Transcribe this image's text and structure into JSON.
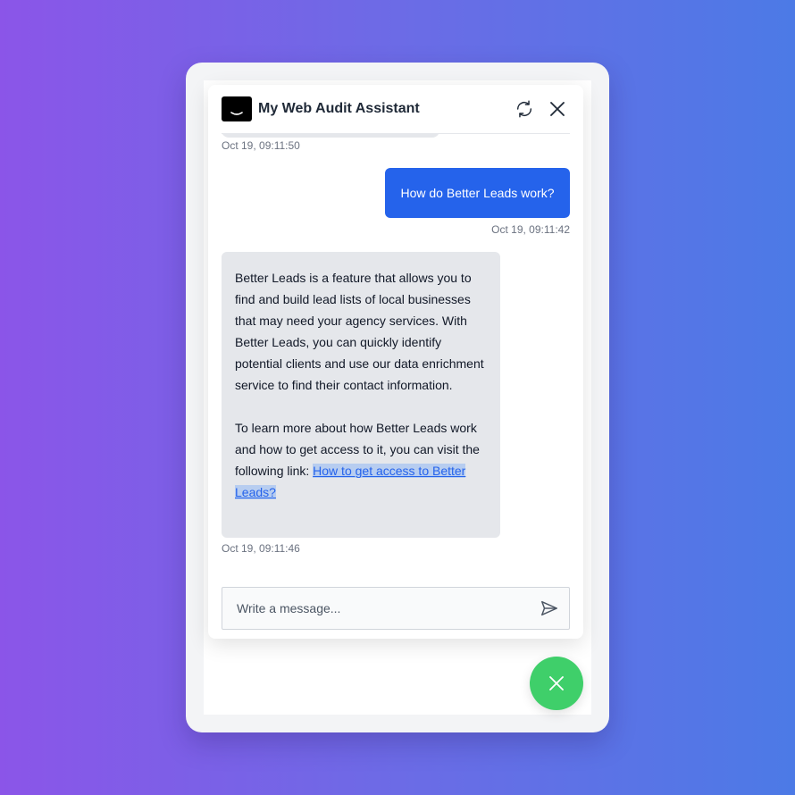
{
  "header": {
    "title": "My Web Audit Assistant",
    "logo_icon": "smile-logo-icon",
    "refresh_icon": "refresh-icon",
    "close_icon": "close-icon"
  },
  "messages": [
    {
      "role": "bot",
      "timestamp": "Oct 19, 09:11:50"
    },
    {
      "role": "user",
      "text": "How do Better Leads work?",
      "timestamp": "Oct 19, 09:11:42"
    },
    {
      "role": "bot",
      "paragraph_1": "Better Leads is a feature that allows you to find and build lead lists of local businesses that may need your agency services. With Better Leads, you can quickly identify potential clients and use our data enrichment service to find their contact information.",
      "paragraph_2_prefix": "To learn more about how Better Leads work and how to get access to it, you can visit the following link: ",
      "link_text": "How to get access to Better Leads?",
      "timestamp": "Oct 19, 09:11:46"
    }
  ],
  "composer": {
    "placeholder": "Write a message...",
    "send_icon": "send-icon"
  },
  "fab": {
    "icon": "close-icon"
  },
  "colors": {
    "user_bubble": "#2563eb",
    "bot_bubble": "#e5e7eb",
    "fab": "#3fcf6a",
    "link": "#2563eb"
  }
}
